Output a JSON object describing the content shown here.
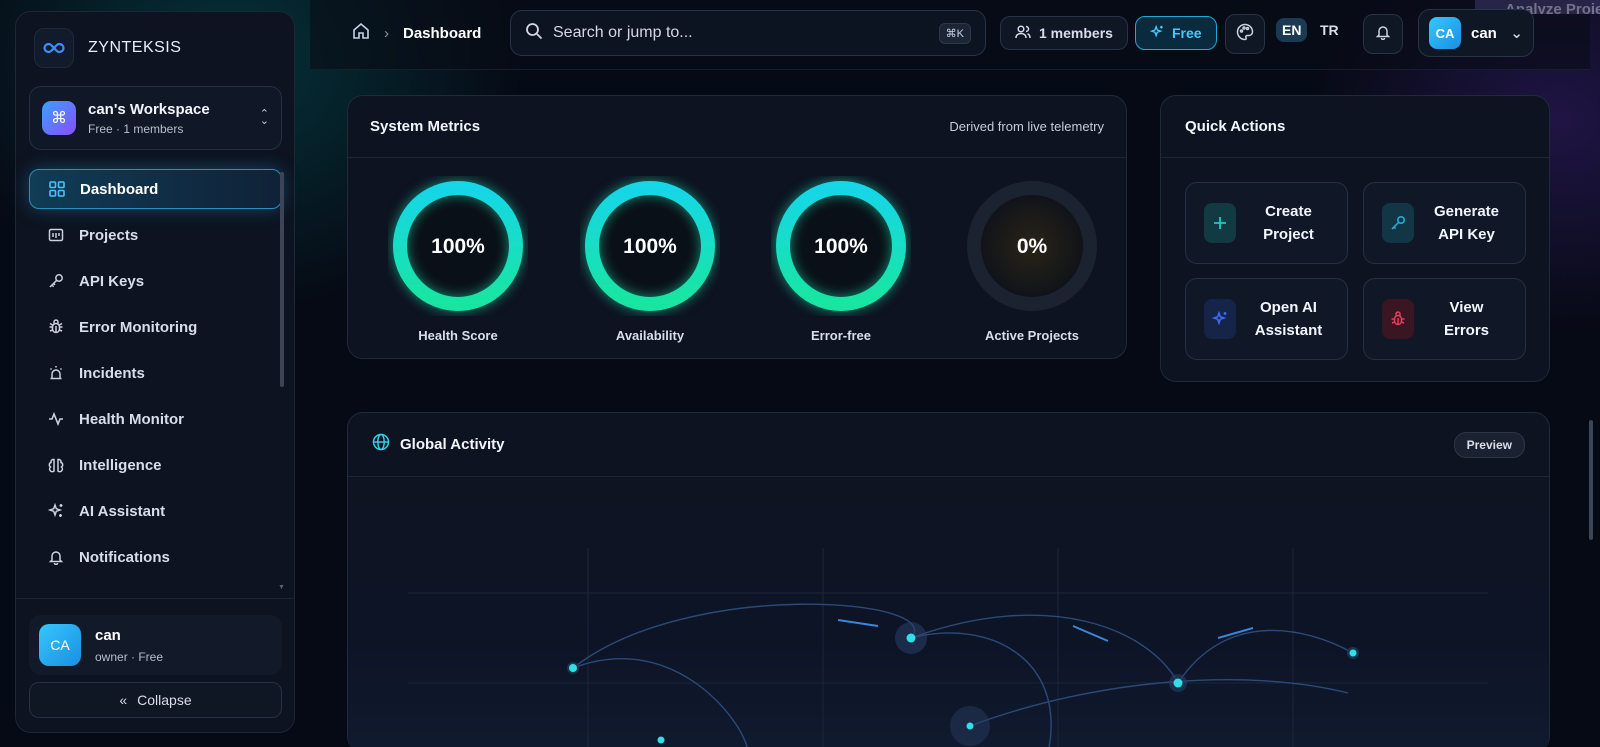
{
  "app": {
    "brand": "ZYNTEKSIS"
  },
  "workspace": {
    "name": "can's Workspace",
    "subtitle": "Free · 1 members"
  },
  "sidebar": {
    "items": [
      {
        "label": "Dashboard",
        "icon": "grid-icon",
        "active": true
      },
      {
        "label": "Projects",
        "icon": "folder-icon"
      },
      {
        "label": "API Keys",
        "icon": "key-icon"
      },
      {
        "label": "Error Monitoring",
        "icon": "bug-icon"
      },
      {
        "label": "Incidents",
        "icon": "siren-icon"
      },
      {
        "label": "Health Monitor",
        "icon": "pulse-icon"
      },
      {
        "label": "Intelligence",
        "icon": "brain-icon"
      },
      {
        "label": "AI Assistant",
        "icon": "sparkles-icon"
      },
      {
        "label": "Notifications",
        "icon": "bell-icon"
      }
    ],
    "user": {
      "initials": "CA",
      "name": "can",
      "subtitle": "owner · Free"
    },
    "collapse_label": "Collapse"
  },
  "header": {
    "breadcrumb_current": "Dashboard",
    "search_placeholder": "Search or jump to...",
    "search_shortcut": "⌘K",
    "members_label": "1 members",
    "plan_label": "Free",
    "lang_en": "EN",
    "lang_tr": "TR",
    "user_initials": "CA",
    "user_name": "can",
    "behind_label": "Analyze Project"
  },
  "metrics": {
    "title": "System Metrics",
    "subtitle": "Derived from live telemetry",
    "gauges": [
      {
        "label": "Health Score",
        "value": "100%",
        "fraction": 1.0
      },
      {
        "label": "Availability",
        "value": "100%",
        "fraction": 1.0
      },
      {
        "label": "Error-free",
        "value": "100%",
        "fraction": 1.0
      },
      {
        "label": "Active Projects",
        "value": "0%",
        "fraction": 0.0
      }
    ]
  },
  "quick_actions": {
    "title": "Quick Actions",
    "items": [
      {
        "label_line1": "Create",
        "label_line2": "Project",
        "icon": "plus-icon",
        "color": "#1ec8c8"
      },
      {
        "label_line1": "Generate",
        "label_line2": "API Key",
        "icon": "key-icon",
        "color": "#2aa8d8"
      },
      {
        "label_line1": "Open AI",
        "label_line2": "Assistant",
        "icon": "sparkles-icon",
        "color": "#3b6cf0"
      },
      {
        "label_line1": "View",
        "label_line2": "Errors",
        "icon": "bug-icon",
        "color": "#e0405a"
      }
    ]
  },
  "activity": {
    "title": "Global Activity",
    "badge": "Preview"
  },
  "colors": {
    "accent": "#2fd0e8",
    "gauge_green": "#18e6a0",
    "gauge_cyan": "#16d6e8"
  }
}
